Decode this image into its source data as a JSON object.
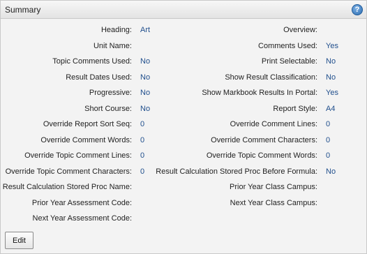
{
  "header": {
    "title": "Summary",
    "help_icon": "question-circle-icon",
    "help_glyph": "?"
  },
  "left": [
    {
      "label": "Heading:",
      "value": "Art"
    },
    {
      "label": "Unit Name:",
      "value": ""
    },
    {
      "label": "Topic Comments Used:",
      "value": "No"
    },
    {
      "label": "Result Dates Used:",
      "value": "No"
    },
    {
      "label": "Progressive:",
      "value": "No"
    },
    {
      "label": "Short Course:",
      "value": "No"
    },
    {
      "label": "Override Report Sort Seq:",
      "value": "0"
    },
    {
      "label": "Override Comment Words:",
      "value": "0"
    },
    {
      "label": "Override Topic Comment Lines:",
      "value": "0"
    },
    {
      "label": "Override Topic Comment Characters:",
      "value": "0"
    },
    {
      "label": "Result Calculation Stored Proc Name:",
      "value": ""
    },
    {
      "label": "Prior Year Assessment Code:",
      "value": ""
    },
    {
      "label": "Next Year Assessment Code:",
      "value": ""
    }
  ],
  "right": [
    {
      "label": "Overview:",
      "value": ""
    },
    {
      "label": "Comments Used:",
      "value": "Yes"
    },
    {
      "label": "Print Selectable:",
      "value": "No"
    },
    {
      "label": "Show Result Classification:",
      "value": "No"
    },
    {
      "label": "Show Markbook Results In Portal:",
      "value": "Yes"
    },
    {
      "label": "Report Style:",
      "value": "A4"
    },
    {
      "label": "Override Comment Lines:",
      "value": "0"
    },
    {
      "label": "Override Comment Characters:",
      "value": "0"
    },
    {
      "label": "Override Topic Comment Words:",
      "value": "0"
    },
    {
      "label": "Result Calculation Stored Proc Before Formula:",
      "value": "No"
    },
    {
      "label": "Prior Year Class Campus:",
      "value": ""
    },
    {
      "label": "Next Year Class Campus:",
      "value": ""
    }
  ],
  "edit_button": {
    "label": "Edit"
  },
  "colors": {
    "value_text": "#1f4e8c",
    "header_bg": "#e3e3e3",
    "panel_bg": "#f3f3f3"
  }
}
